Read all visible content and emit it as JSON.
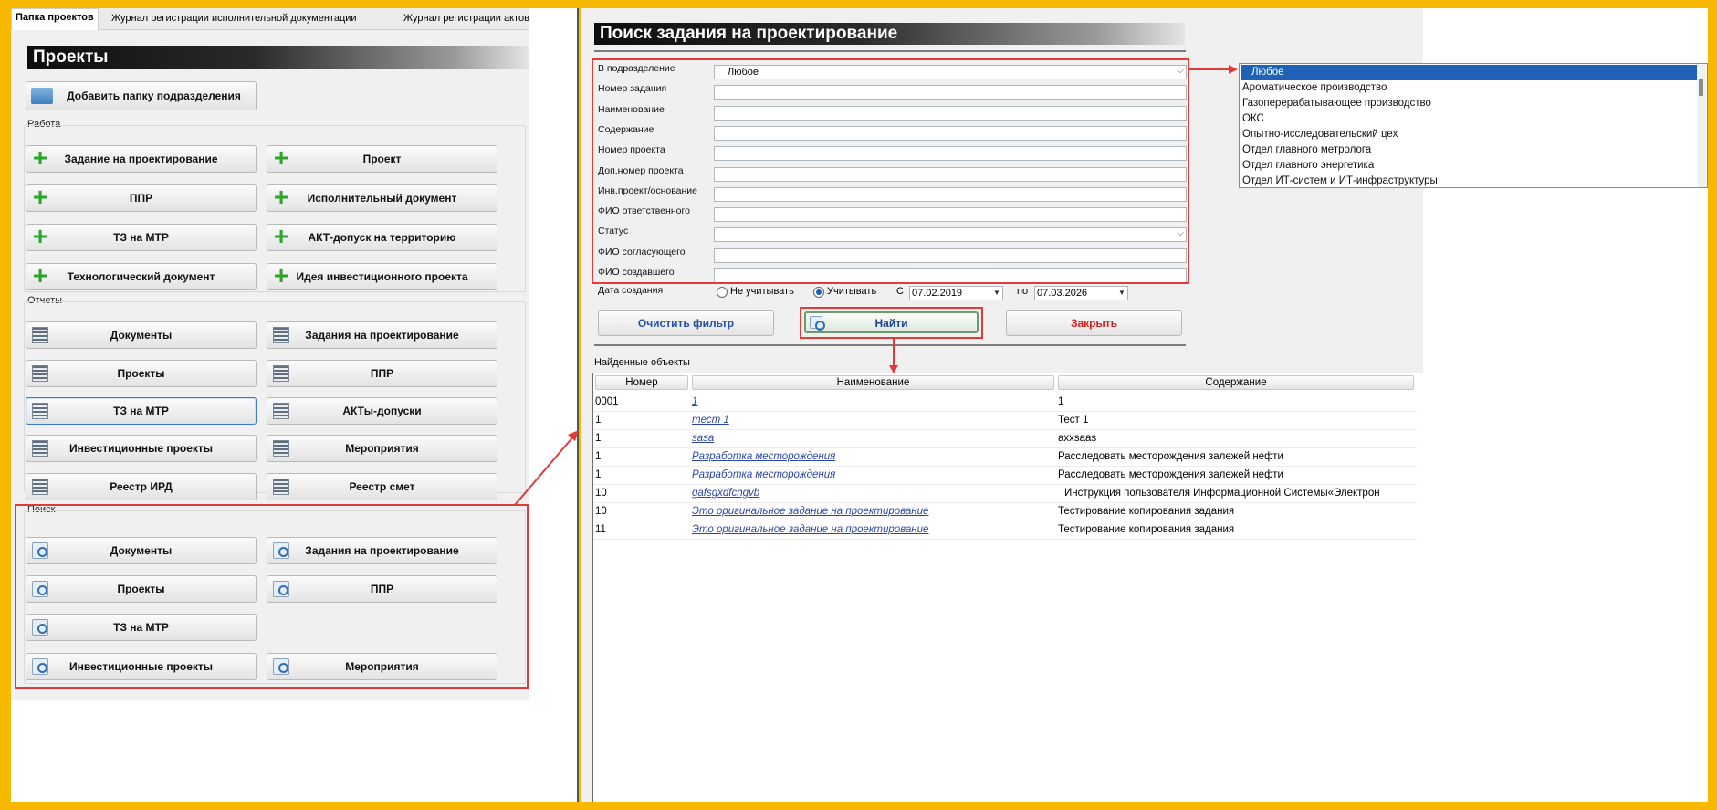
{
  "tabs": [
    "Папка проектов",
    "Журнал регистрации исполнительной документации",
    "Журнал регистрации актов"
  ],
  "projects": {
    "title": "Проекты",
    "add_folder_label": "Добавить папку подразделения",
    "groups": {
      "work": {
        "label": "Работа",
        "buttons": [
          "Задание на проектирование",
          "Проект",
          "ППР",
          "Исполнительный документ",
          "ТЗ на МТР",
          "АКТ-допуск на территорию",
          "Технологический документ",
          "Идея инвестиционного проекта"
        ]
      },
      "reports": {
        "label": "Отчеты",
        "buttons": [
          "Документы",
          "Задания на проектирование",
          "Проекты",
          "ППР",
          "ТЗ на МТР",
          "АКТы-допуски",
          "Инвестиционные проекты",
          "Мероприятия",
          "Реестр ИРД",
          "Реестр смет"
        ]
      },
      "search": {
        "label": "Поиск",
        "buttons": [
          "Документы",
          "Задания на проектирование",
          "Проекты",
          "ППР",
          "ТЗ на МТР",
          "Инвестиционные проекты",
          "Мероприятия"
        ]
      }
    }
  },
  "search_form": {
    "title": "Поиск задания на проектирование",
    "fields": [
      {
        "label": "В подразделение",
        "value": "Любое"
      },
      {
        "label": "Номер задания",
        "value": ""
      },
      {
        "label": "Наименование",
        "value": ""
      },
      {
        "label": "Содержание",
        "value": ""
      },
      {
        "label": "Номер проекта",
        "value": ""
      },
      {
        "label": "Доп.номер проекта",
        "value": ""
      },
      {
        "label": "Инв.проект/основание",
        "value": ""
      },
      {
        "label": "ФИО ответственного",
        "value": ""
      },
      {
        "label": "Статус",
        "value": ""
      },
      {
        "label": "ФИО согласующего",
        "value": ""
      },
      {
        "label": "ФИО создавшего",
        "value": ""
      }
    ],
    "date": {
      "label": "Дата создания",
      "option_ignore": "Не учитывать",
      "option_use": "Учитывать",
      "from_label": "С",
      "from_value": "07.02.2019",
      "to_label": "по",
      "to_value": "07.03.2026"
    },
    "buttons": {
      "clear": "Очистить фильтр",
      "find": "Найти",
      "close": "Закрыть"
    },
    "colors": {
      "clear": "#2451a6",
      "find": "#1f3f8f",
      "close": "#d62020"
    }
  },
  "results": {
    "label": "Найденные объекты",
    "columns": [
      "Номер",
      "Наименование",
      "Содержание"
    ],
    "rows": [
      {
        "num": "0001",
        "name": "1",
        "content": "1"
      },
      {
        "num": "1",
        "name": "тест 1",
        "content": "Тест 1"
      },
      {
        "num": "1",
        "name": "sasa",
        "content": "axxsaas"
      },
      {
        "num": "1",
        "name": "Разработка месторождения",
        "content": "Расследовать месторождения залежей нефти"
      },
      {
        "num": "1",
        "name": "Разработка месторождения",
        "content": "Расследовать месторождения залежей нефти"
      },
      {
        "num": "10",
        "name": "gafsgxdfcngvb",
        "content": "Инструкция пользователя Информационной Системы«Электрон"
      },
      {
        "num": "10",
        "name": "Это оригинальное задание на проектирование",
        "content": "Тестирование копирования задания"
      },
      {
        "num": "11",
        "name": "Это оригинальное задание на проектирование",
        "content": "Тестирование копирования задания"
      }
    ]
  },
  "division_dropdown": {
    "options": [
      "Любое",
      "Ароматическое производство",
      "Газоперерабатывающее производство",
      "ОКС",
      "Опытно-исследовательский цех",
      "Отдел главного метролога",
      "Отдел главного энергетика",
      "Отдел ИТ-систем и ИТ-инфраструктуры"
    ],
    "selected": "Любое"
  },
  "colors": {
    "frame": "#f9b800",
    "highlight": "#e03a3a",
    "selection": "#2062b8",
    "link": "#2a47a8"
  }
}
